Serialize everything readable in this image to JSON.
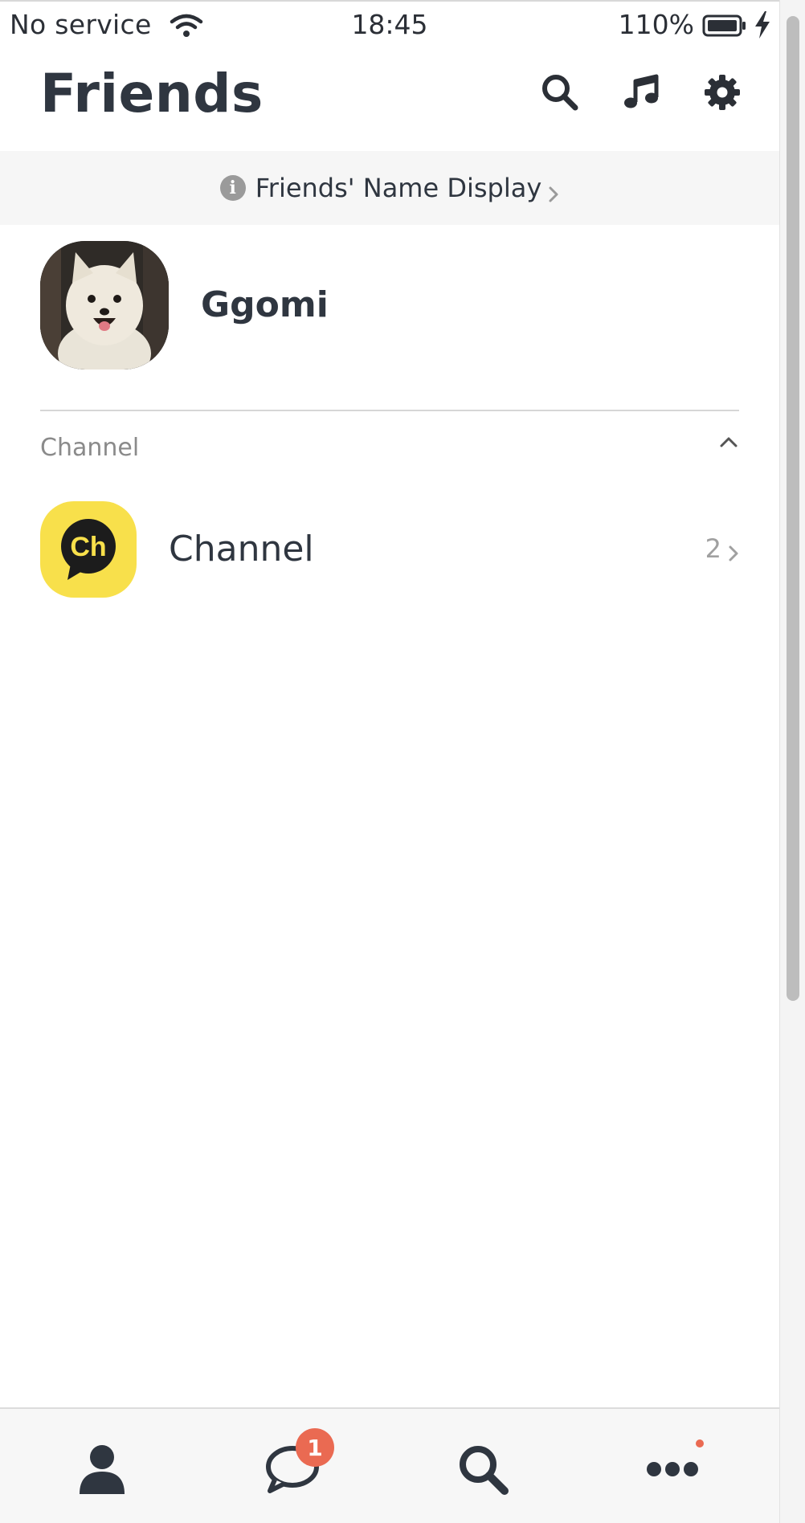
{
  "status_bar": {
    "carrier": "No service",
    "time": "18:45",
    "battery": "110%"
  },
  "header": {
    "title": "Friends",
    "icons": [
      "search-icon",
      "music-icon",
      "settings-icon"
    ]
  },
  "name_display": {
    "label": "Friends' Name Display"
  },
  "profile": {
    "name": "Ggomi"
  },
  "channel_section": {
    "label": "Channel",
    "item": {
      "logo_text": "Ch",
      "name": "Channel",
      "count": "2"
    }
  },
  "tab_bar": {
    "tabs": [
      "friends-tab",
      "chats-tab",
      "search-tab",
      "more-tab"
    ],
    "chat_badge": "1"
  },
  "colors": {
    "text_dark": "#2f3640",
    "channel_yellow": "#f8e04b",
    "badge_red": "#ea6a52",
    "banner_bg": "#f6f6f6"
  }
}
